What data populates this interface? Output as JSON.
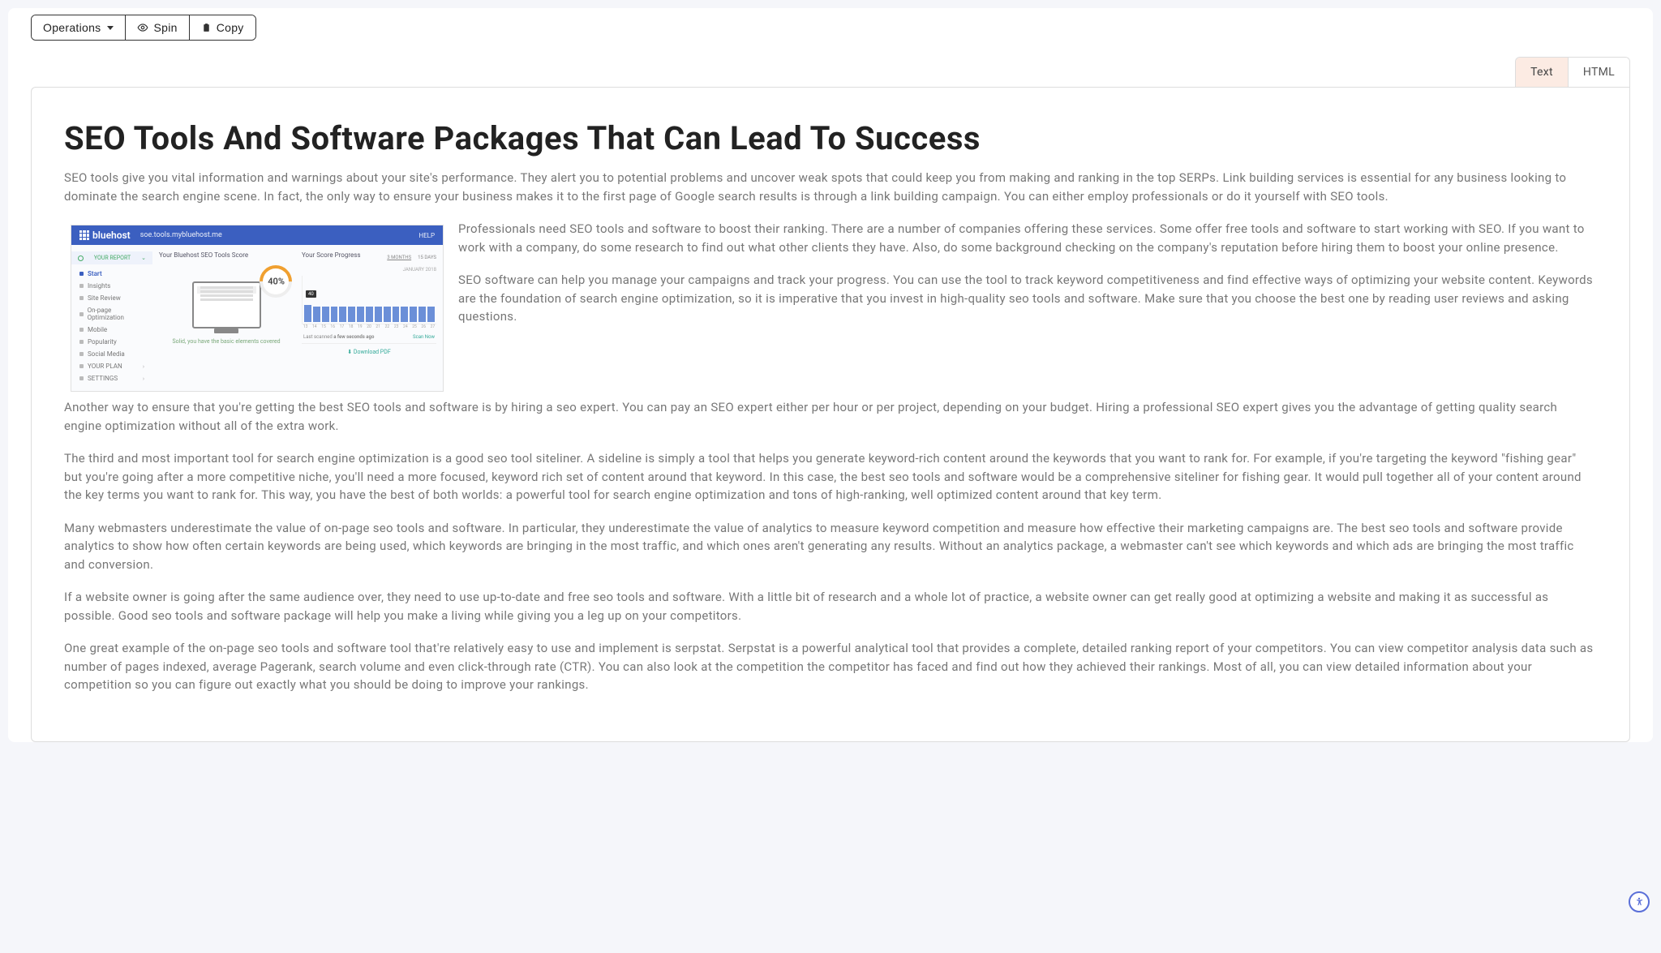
{
  "toolbar": {
    "operations_label": "Operations",
    "spin_label": "Spin",
    "copy_label": "Copy"
  },
  "tabs": {
    "text_label": "Text",
    "html_label": "HTML"
  },
  "article": {
    "title": "SEO Tools And Software Packages That Can Lead To Success",
    "p1": "SEO tools give you vital information and warnings about your site's performance. They alert you to potential problems and uncover weak spots that could keep you from making and ranking in the top SERPs. Link building services is essential for any business looking to dominate the search engine scene. In fact, the only way to ensure your business makes it to the first page of Google search results is through a link building campaign. You can either employ professionals or do it yourself with SEO tools.",
    "p2": "Professionals need SEO tools and software to boost their ranking. There are a number of companies offering these services. Some offer free tools and software to start working with SEO. If you want to work with a company, do some research to find out what other clients they have. Also, do some background checking on the company's reputation before hiring them to boost your online presence.",
    "p3": "SEO software can help you manage your campaigns and track your progress. You can use the tool to track keyword competitiveness and find effective ways of optimizing your website content. Keywords are the foundation of search engine optimization, so it is imperative that you invest in high-quality seo tools and software. Make sure that you choose the best one by reading user reviews and asking questions.",
    "p4": "Another way to ensure that you're getting the best SEO tools and software is by hiring a seo expert. You can pay an SEO expert either per hour or per project, depending on your budget. Hiring a professional SEO expert gives you the advantage of getting quality search engine optimization without all of the extra work.",
    "p5": "The third and most important tool for search engine optimization is a good seo tool siteliner. A sideline is simply a tool that helps you generate keyword-rich content around the keywords that you want to rank for. For example, if you're targeting the keyword \"fishing gear\" but you're going after a more competitive niche, you'll need a more focused, keyword rich set of content around that keyword. In this case, the best seo tools and software would be a comprehensive siteliner for fishing gear. It would pull together all of your content around the key terms you want to rank for. This way, you have the best of both worlds: a powerful tool for search engine optimization and tons of high-ranking, well optimized content around that key term.",
    "p6": "Many webmasters underestimate the value of on-page seo tools and software. In particular, they underestimate the value of analytics to measure keyword competition and measure how effective their marketing campaigns are. The best seo tools and software provide analytics to show how often certain keywords are being used, which keywords are bringing in the most traffic, and which ones aren't generating any results. Without an analytics package, a webmaster can't see which keywords and which ads are bringing the most traffic and conversion.",
    "p7": "If a website owner is going after the same audience over, they need to use up-to-date and free seo tools and software. With a little bit of research and a whole lot of practice, a website owner can get really good at optimizing a website and making it as successful as possible. Good seo tools and software package will help you make a living while giving you a leg up on your competitors.",
    "p8": "One great example of the on-page seo tools and software tool that're relatively easy to use and implement is serpstat. Serpstat is a powerful analytical tool that provides a complete, detailed ranking report of your competitors. You can view competitor analysis data such as number of pages indexed, average Pagerank, search volume and even click-through rate (CTR). You can also look at the competition the competitor has faced and find out how they achieved their rankings. Most of all, you can view detailed information about your competition so you can figure out exactly what you should be doing to improve your rankings."
  },
  "embedded_screenshot": {
    "brand": "bluehost",
    "url": "soe.tools.mybluehost.me",
    "help": "HELP",
    "sidebar": {
      "report_label": "YOUR REPORT",
      "items": [
        "Start",
        "Insights",
        "Site Review",
        "On-page Optimization",
        "Mobile",
        "Popularity",
        "Social Media"
      ],
      "plan_label": "YOUR PLAN",
      "settings_label": "SETTINGS"
    },
    "score_panel": {
      "title": "Your Bluehost SEO Tools Score",
      "score": "40%",
      "caption": "Solid, you have the basic elements covered"
    },
    "progress_panel": {
      "title": "Your Score Progress",
      "range_options": [
        "3 MONTHS",
        "15 DAYS"
      ],
      "date_label": "JANUARY 2018",
      "tooltip": "40",
      "x_labels": [
        "13",
        "14",
        "15",
        "16",
        "17",
        "18",
        "19",
        "20",
        "21",
        "22",
        "23",
        "24",
        "25",
        "26",
        "27"
      ],
      "last_scanned_prefix": "Last scanned ",
      "last_scanned_value": "a few seconds ago",
      "scan_now": "Scan Now",
      "download": "Download PDF"
    }
  },
  "chart_data": {
    "type": "bar",
    "title": "Your Score Progress",
    "categories": [
      "13",
      "14",
      "15",
      "16",
      "17",
      "18",
      "19",
      "20",
      "21",
      "22",
      "23",
      "24",
      "25",
      "26",
      "27"
    ],
    "values": [
      40,
      35,
      35,
      35,
      35,
      35,
      35,
      35,
      35,
      35,
      35,
      35,
      35,
      35,
      35
    ],
    "ylim": [
      0,
      100
    ],
    "xlabel": "JANUARY 2018",
    "ylabel": ""
  }
}
